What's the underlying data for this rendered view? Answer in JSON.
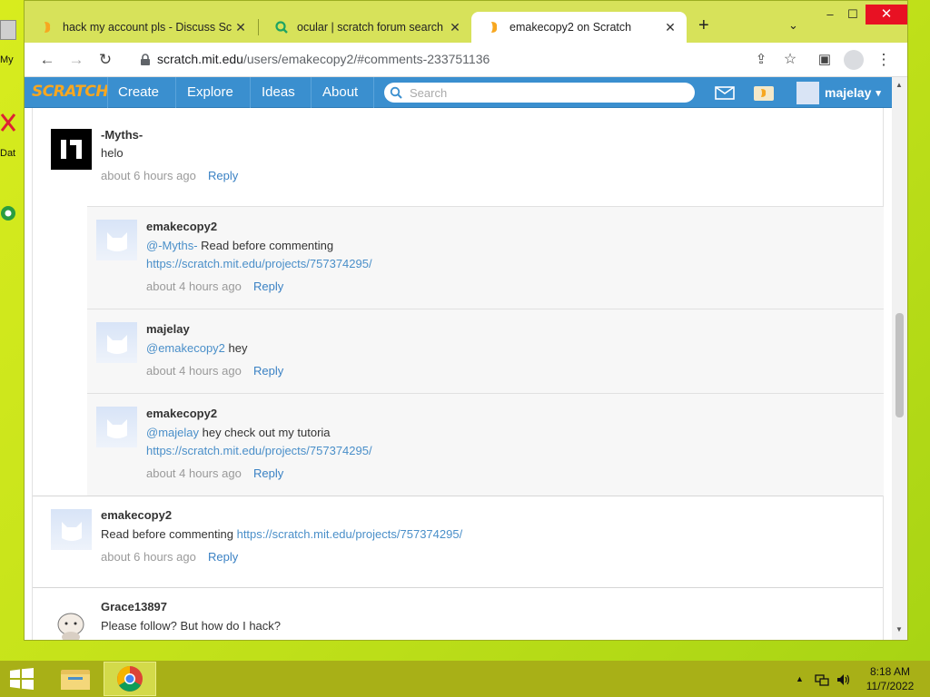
{
  "desktop": {
    "fragments": [
      "My",
      "Dat"
    ]
  },
  "browser": {
    "tabs": [
      {
        "label": "hack my account pls - Discuss Sc",
        "close": "✕"
      },
      {
        "label": "ocular | scratch forum search",
        "close": "✕"
      },
      {
        "label": "emakecopy2 on Scratch",
        "close": "✕"
      }
    ],
    "new_tab": "+",
    "tab_search": "⌄",
    "window_controls": {
      "minimize": "–",
      "maximize": "☐",
      "close": "✕"
    },
    "url_host": "scratch.mit.edu",
    "url_path": "/users/emakecopy2/#comments-233751136"
  },
  "scratch_nav": {
    "logo": "SCRATCH",
    "links": [
      "Create",
      "Explore",
      "Ideas",
      "About"
    ],
    "search_placeholder": "Search",
    "username": "majelay",
    "caret": "▾"
  },
  "comments": [
    {
      "name": "-Myths-",
      "text": "helo",
      "time": "about 6 hours ago",
      "reply": "Reply"
    },
    {
      "name": "emakecopy2",
      "mention": "@-Myths-",
      "text": " Read before commenting",
      "link": "https://scratch.mit.edu/projects/757374295/",
      "time": "about 4 hours ago",
      "reply": "Reply"
    },
    {
      "name": "majelay",
      "mention": "@emakecopy2",
      "text": " hey",
      "time": "about 4 hours ago",
      "reply": "Reply"
    },
    {
      "name": "emakecopy2",
      "mention": "@majelay",
      "text": " hey check out my tutoria",
      "link": "https://scratch.mit.edu/projects/757374295/",
      "time": "about 4 hours ago",
      "reply": "Reply"
    },
    {
      "name": "emakecopy2",
      "text": "Read before commenting ",
      "link": "https://scratch.mit.edu/projects/757374295/",
      "time": "about 6 hours ago",
      "reply": "Reply"
    },
    {
      "name": "Grace13897",
      "text": "Please follow? But how do I hack?"
    }
  ],
  "taskbar": {
    "time": "8:18 AM",
    "date": "11/7/2022"
  },
  "colors": {
    "scratch_blue": "#3a8fcf",
    "link_blue": "#4a8fc9",
    "desktop_bg": "#d8ec1e",
    "taskbar": "#a8b017"
  }
}
